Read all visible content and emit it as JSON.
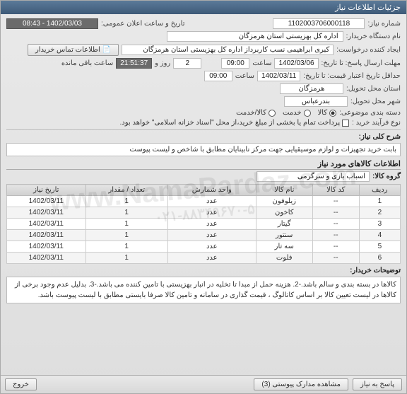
{
  "window": {
    "title": "جزئیات اطلاعات نیاز"
  },
  "fields": {
    "need_number_label": "شماره نیاز:",
    "need_number": "1102003706000118",
    "announce_label": "تاریخ و ساعت اعلان عمومی:",
    "announce_value": "1402/03/03 - 08:43",
    "buyer_org_label": "نام دستگاه خریدار:",
    "buyer_org": "اداره کل بهزیستی استان هرمزگان",
    "requester_label": "ایجاد کننده درخواست:",
    "requester": "کبری  ابراهیمی نسب کاربرداز اداره کل بهزیستی استان هرمزگان",
    "contact_btn": "اطلاعات تماس خریدار",
    "deadline_label": "مهلت ارسال پاسخ: تا تاریخ:",
    "deadline_date": "1402/03/06",
    "time_label": "ساعت",
    "deadline_time": "09:00",
    "days_remaining": "2",
    "days_remaining_label": "روز و",
    "countdown": "21:51:37",
    "countdown_label": "ساعت باقی مانده",
    "validity_label": "حداقل تاریخ اعتبار قیمت: تا تاریخ:",
    "validity_date": "1402/03/11",
    "validity_time": "09:00",
    "province_label": "استان محل تحویل:",
    "province": "هرمزگان",
    "city_label": "شهر محل تحویل:",
    "city": "بندرعباس",
    "topic_group_label": "دسته بندی موضوعی:",
    "radio_goods": "کالا",
    "radio_service": "خدمت",
    "radio_both": "کالا/خدمت",
    "process_label": "نوع فرآیند خرید :",
    "process_note": "پرداخت تمام یا بخشی از مبلغ خرید،از محل \"اسناد خزانه اسلامی\" خواهد بود.",
    "desc_title": "شرح کلی نیاز:",
    "desc_text": "بابت خرید تجهیزات و لوازم موسیقیایی جهت مرکز نابینایان مطابق با شاخص و لیست پیوست",
    "items_title": "اطلاعات کالاهای مورد نیاز",
    "group_label": "گروه کالا:",
    "group_value": "اسباب بازی و سرگرمی",
    "remarks_label": "توضیحات خریدار:",
    "remarks_text": "کالاها در بسته بندی و سالم باشد.-2. هزینه حمل از مبدا تا تخلیه در انبار بهزیستی با تامین کننده می باشد.-3. بدلیل عدم وجود برخی از کالاها در لیست تعیین کالا بر اساس کاتالوگ ، قیمت گذاری در سامانه و  تامین کالا صرفا بایستی مطابق با لیست پیوست باشد."
  },
  "table": {
    "headers": [
      "ردیف",
      "کد کالا",
      "نام کالا",
      "واحد شمارش",
      "تعداد / مقدار",
      "تاریخ نیاز"
    ],
    "rows": [
      [
        "1",
        "--",
        "زیلوفون",
        "عدد",
        "1",
        "1402/03/11"
      ],
      [
        "2",
        "--",
        "کاخون",
        "عدد",
        "1",
        "1402/03/11"
      ],
      [
        "3",
        "--",
        "گیتار",
        "عدد",
        "1",
        "1402/03/11"
      ],
      [
        "4",
        "--",
        "سنتور",
        "عدد",
        "1",
        "1402/03/11"
      ],
      [
        "5",
        "--",
        "سه تار",
        "عدد",
        "1",
        "1402/03/11"
      ],
      [
        "6",
        "--",
        "فلوت",
        "عدد",
        "1",
        "1402/03/11"
      ]
    ]
  },
  "footer": {
    "reply": "پاسخ به نیاز",
    "attachments": "مشاهده مدارک پیوستی (3)",
    "exit": "خروج"
  }
}
